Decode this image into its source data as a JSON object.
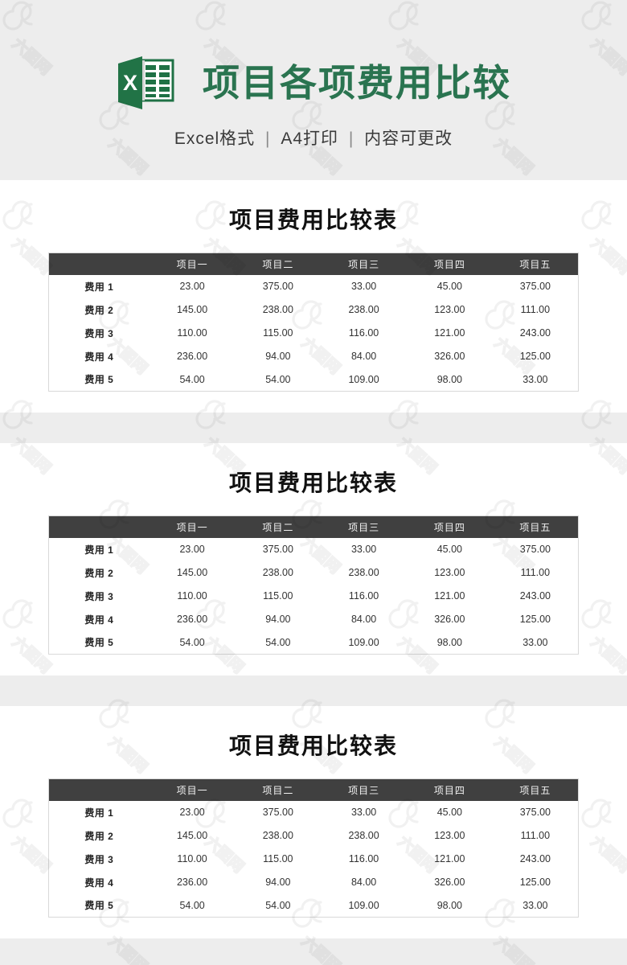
{
  "header": {
    "icon_name": "excel-file-icon",
    "icon_letter": "X",
    "title": "项目各项费用比较",
    "subtitle_parts": [
      "Excel格式",
      "A4打印",
      "内容可更改"
    ],
    "subtitle_separator": "|",
    "title_color": "#2a7450"
  },
  "watermark": {
    "logo_text": "dc",
    "text": "六图网"
  },
  "colors": {
    "background": "#ededed",
    "card": "#ffffff",
    "table_header_bg": "#404040",
    "table_header_text": "#f2f2f2",
    "table_border": "#d9d9d9",
    "brand_green": "#2a7450"
  },
  "chart_data": {
    "type": "table",
    "title": "项目费用比较表",
    "categories": [
      "项目一",
      "项目二",
      "项目三",
      "项目四",
      "项目五"
    ],
    "row_labels": [
      "费用 1",
      "费用 2",
      "费用 3",
      "费用 4",
      "费用 5"
    ],
    "series": [
      {
        "name": "费用 1",
        "values": [
          23.0,
          375.0,
          33.0,
          45.0,
          375.0
        ]
      },
      {
        "name": "费用 2",
        "values": [
          145.0,
          238.0,
          238.0,
          123.0,
          111.0
        ]
      },
      {
        "name": "费用 3",
        "values": [
          110.0,
          115.0,
          116.0,
          121.0,
          243.0
        ]
      },
      {
        "name": "费用 4",
        "values": [
          236.0,
          94.0,
          84.0,
          326.0,
          125.0
        ]
      },
      {
        "name": "费用 5",
        "values": [
          54.0,
          54.0,
          109.0,
          98.0,
          33.0
        ]
      }
    ]
  },
  "tables": [
    {
      "title": "项目费用比较表",
      "corner_label": "",
      "columns": [
        "项目一",
        "项目二",
        "项目三",
        "项目四",
        "项目五"
      ],
      "rows": [
        {
          "label": "费用 1",
          "values": [
            "23.00",
            "375.00",
            "33.00",
            "45.00",
            "375.00"
          ]
        },
        {
          "label": "费用 2",
          "values": [
            "145.00",
            "238.00",
            "238.00",
            "123.00",
            "111.00"
          ]
        },
        {
          "label": "费用 3",
          "values": [
            "110.00",
            "115.00",
            "116.00",
            "121.00",
            "243.00"
          ]
        },
        {
          "label": "费用 4",
          "values": [
            "236.00",
            "94.00",
            "84.00",
            "326.00",
            "125.00"
          ]
        },
        {
          "label": "费用 5",
          "values": [
            "54.00",
            "54.00",
            "109.00",
            "98.00",
            "33.00"
          ]
        }
      ]
    },
    {
      "title": "项目费用比较表",
      "corner_label": "",
      "columns": [
        "项目一",
        "项目二",
        "项目三",
        "项目四",
        "项目五"
      ],
      "rows": [
        {
          "label": "费用 1",
          "values": [
            "23.00",
            "375.00",
            "33.00",
            "45.00",
            "375.00"
          ]
        },
        {
          "label": "费用 2",
          "values": [
            "145.00",
            "238.00",
            "238.00",
            "123.00",
            "111.00"
          ]
        },
        {
          "label": "费用 3",
          "values": [
            "110.00",
            "115.00",
            "116.00",
            "121.00",
            "243.00"
          ]
        },
        {
          "label": "费用 4",
          "values": [
            "236.00",
            "94.00",
            "84.00",
            "326.00",
            "125.00"
          ]
        },
        {
          "label": "费用 5",
          "values": [
            "54.00",
            "54.00",
            "109.00",
            "98.00",
            "33.00"
          ]
        }
      ]
    },
    {
      "title": "项目费用比较表",
      "corner_label": "",
      "columns": [
        "项目一",
        "项目二",
        "项目三",
        "项目四",
        "项目五"
      ],
      "rows": [
        {
          "label": "费用 1",
          "values": [
            "23.00",
            "375.00",
            "33.00",
            "45.00",
            "375.00"
          ]
        },
        {
          "label": "费用 2",
          "values": [
            "145.00",
            "238.00",
            "238.00",
            "123.00",
            "111.00"
          ]
        },
        {
          "label": "费用 3",
          "values": [
            "110.00",
            "115.00",
            "116.00",
            "121.00",
            "243.00"
          ]
        },
        {
          "label": "费用 4",
          "values": [
            "236.00",
            "94.00",
            "84.00",
            "326.00",
            "125.00"
          ]
        },
        {
          "label": "费用 5",
          "values": [
            "54.00",
            "54.00",
            "109.00",
            "98.00",
            "33.00"
          ]
        }
      ]
    }
  ]
}
